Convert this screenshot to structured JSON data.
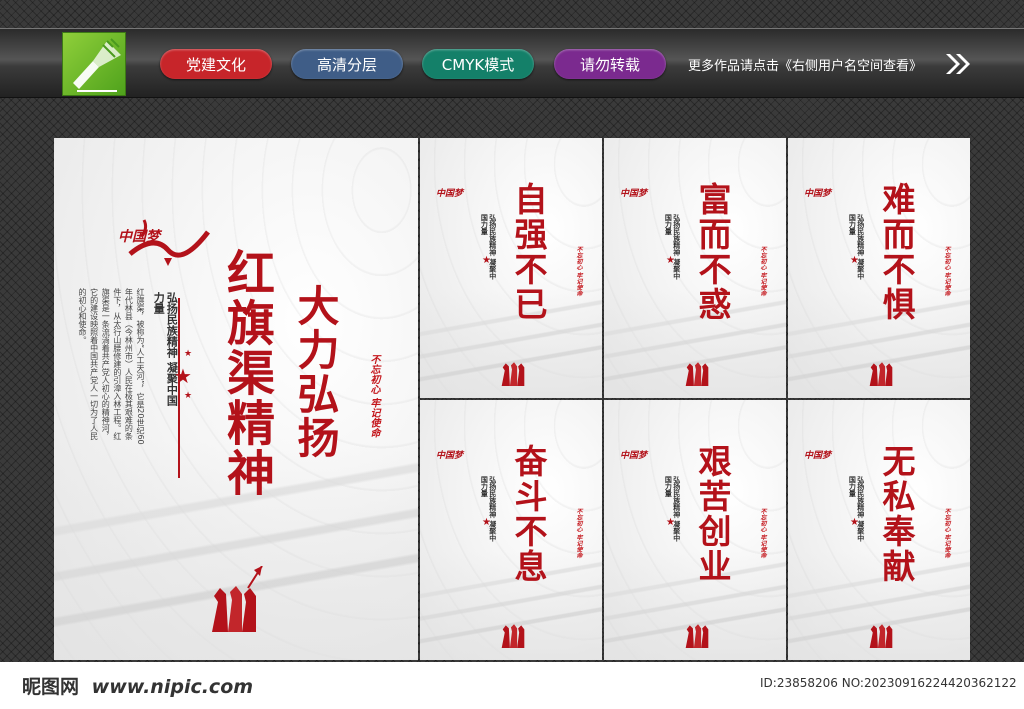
{
  "header": {
    "tags": [
      {
        "label": "党建文化",
        "color": "#c7252a"
      },
      {
        "label": "高清分层",
        "color": "#3f5d87"
      },
      {
        "label": "CMYK模式",
        "color": "#148069"
      },
      {
        "label": "请勿转载",
        "color": "#7b2a8f"
      }
    ],
    "note": "更多作品请点击《右侧用户名空间查看》"
  },
  "main_poster": {
    "brand": "中国梦",
    "title": "红旗渠精神",
    "slogan": "大力弘扬",
    "subtitle": "弘扬民族精神 凝聚中国力量",
    "body": "红旗渠，被称为“人工天河”，它是20世纪60年代林县（今林州市）人民在极其艰难的条件下，从太行山腰修建的引漳入林工程。红旗渠是一条流淌着共产党人初心的精神河，它的建设映照着中国共产党人一切为了人民的初心和使命。",
    "seal": "不忘初心 牢记使命"
  },
  "small_posters": [
    {
      "title": "自强不已",
      "brand": "中国梦",
      "subtitle": "弘扬民族精神 凝聚中国力量",
      "seal": "不忘初心 牢记使命"
    },
    {
      "title": "富而不惑",
      "brand": "中国梦",
      "subtitle": "弘扬民族精神 凝聚中国力量",
      "seal": "不忘初心 牢记使命"
    },
    {
      "title": "难而不惧",
      "brand": "中国梦",
      "subtitle": "弘扬民族精神 凝聚中国力量",
      "seal": "不忘初心 牢记使命"
    },
    {
      "title": "奋斗不息",
      "brand": "中国梦",
      "subtitle": "弘扬民族精神 凝聚中国力量",
      "seal": "不忘初心 牢记使命"
    },
    {
      "title": "艰苦创业",
      "brand": "中国梦",
      "subtitle": "弘扬民族精神 凝聚中国力量",
      "seal": "不忘初心 牢记使命"
    },
    {
      "title": "无私奉献",
      "brand": "中国梦",
      "subtitle": "弘扬民族精神 凝聚中国力量",
      "seal": "不忘初心 牢记使命"
    }
  ],
  "footer": {
    "site_cn": "昵图网",
    "site_url": "www.nipic.com",
    "id_line": "ID:23858206 NO:20230916224420362122"
  },
  "colors": {
    "accent_red": "#b3121a",
    "logo_green": "#6cbc2c"
  }
}
